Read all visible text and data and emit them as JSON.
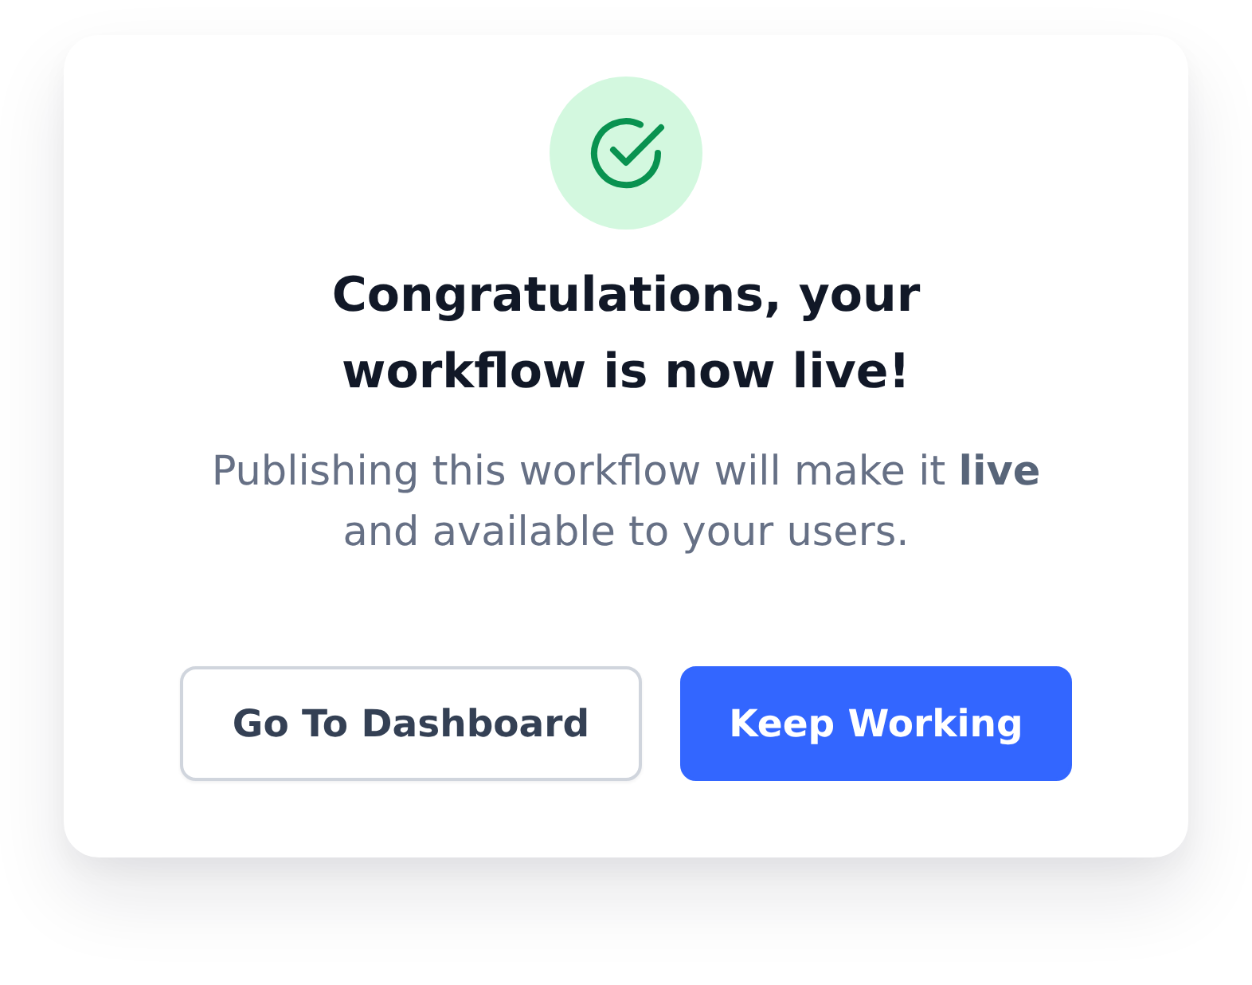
{
  "dialog": {
    "title": "Congratulations, your workflow is now live!",
    "message": "Publishing this workflow will make it **live** and available to your users.",
    "buttons": [
      {
        "label": "Go To Dashboard",
        "kind": "secondary"
      },
      {
        "label": "Keep Working",
        "kind": "primary"
      }
    ]
  }
}
